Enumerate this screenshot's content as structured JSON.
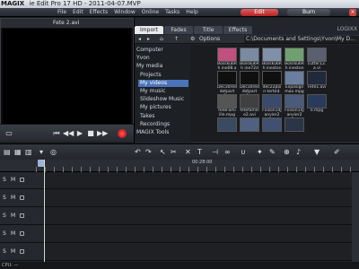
{
  "window": {
    "title": "ie Edit Pro 17 HD - 2011-04-07.MVP",
    "logo": "MAGIX"
  },
  "menu": [
    "File",
    "Edit",
    "Effects",
    "Window",
    "Online",
    "Tasks",
    "Help"
  ],
  "mode_buttons": {
    "edit": "Edit",
    "burn": "Burn"
  },
  "monitor": {
    "title": "Fete 2.avi"
  },
  "media_pool": {
    "tabs": [
      "Import",
      "Fades",
      "Title",
      "Effects"
    ],
    "brand": "LOGIXX",
    "options_label": "Options",
    "path": "C:\\Documents and Settings\\Yvon\\My D...",
    "tree": [
      {
        "label": "Computer",
        "indent": false,
        "selected": false
      },
      {
        "label": "Yvon",
        "indent": false,
        "selected": false
      },
      {
        "label": "My media",
        "indent": false,
        "selected": false
      },
      {
        "label": "Projects",
        "indent": true,
        "selected": false
      },
      {
        "label": "My videos",
        "indent": true,
        "selected": true
      },
      {
        "label": "My music",
        "indent": true,
        "selected": false
      },
      {
        "label": "Slideshow Music",
        "indent": true,
        "selected": false
      },
      {
        "label": "My pictures",
        "indent": true,
        "selected": false
      },
      {
        "label": "Takes",
        "indent": true,
        "selected": false
      },
      {
        "label": "Recordings",
        "indent": true,
        "selected": false
      },
      {
        "label": "MAGIX Tools",
        "indent": false,
        "selected": false
      }
    ],
    "files": [
      {
        "name": "Bossku6Rh ine08.avi",
        "color": "#c05080"
      },
      {
        "name": "Bossku6Rh ine72de...",
        "color": "#7a8aa0"
      },
      {
        "name": "Bossku6Rh inestone...",
        "color": "#8090a8"
      },
      {
        "name": "Bossku6Rh inestone...",
        "color": "#70a070"
      },
      {
        "name": "cutter12.a vi",
        "color": "#5a6070"
      },
      {
        "name": "Dec30red dotpart1...",
        "color": "#101010"
      },
      {
        "name": "Dec30red dotpart1...",
        "color": "#101010"
      },
      {
        "name": "dec22poin terted.a...",
        "color": "#101010"
      },
      {
        "name": "Exposige max.mpg",
        "color": "#6a7ea0"
      },
      {
        "name": "Fete1.avi",
        "color": "#202a3a"
      },
      {
        "name": "feteFami ille.mpg",
        "color": "#555555"
      },
      {
        "name": "fetefamill e2.avi",
        "color": "#404040"
      },
      {
        "name": "Foison14J anvier20...",
        "color": "#3a4a6a"
      },
      {
        "name": "Foison14J anvier20...",
        "color": "#4a5a7a"
      },
      {
        "name": "e.mpg",
        "color": "#2a3a5a"
      },
      {
        "name": "",
        "color": "#3a4a60"
      },
      {
        "name": "",
        "color": "#506080"
      },
      {
        "name": "",
        "color": "#405070"
      },
      {
        "name": "",
        "color": "#2a3548"
      }
    ]
  },
  "timeline": {
    "ruler_time": "00:28:00",
    "tracks": [
      "1",
      "2",
      "3",
      "4",
      "5"
    ],
    "track_solo": "S",
    "track_mute": "M"
  },
  "status": {
    "text": "CPU: —"
  }
}
